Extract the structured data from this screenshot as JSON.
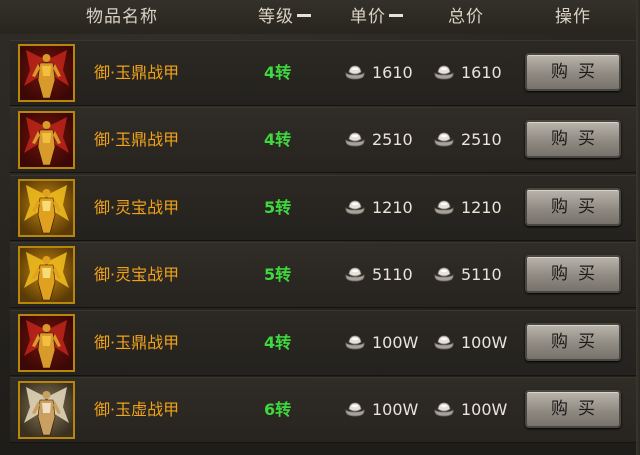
{
  "header": {
    "name": "物品名称",
    "level": "等级",
    "unit_price": "单价",
    "total_price": "总价",
    "action": "操作"
  },
  "rows": [
    {
      "name": "御·玉鼎战甲",
      "level": "4转",
      "unit_price": "1610",
      "total_price": "1610",
      "buy_label": "购买",
      "art": "red"
    },
    {
      "name": "御·玉鼎战甲",
      "level": "4转",
      "unit_price": "2510",
      "total_price": "2510",
      "buy_label": "购买",
      "art": "red"
    },
    {
      "name": "御·灵宝战甲",
      "level": "5转",
      "unit_price": "1210",
      "total_price": "1210",
      "buy_label": "购买",
      "art": "gold"
    },
    {
      "name": "御·灵宝战甲",
      "level": "5转",
      "unit_price": "5110",
      "total_price": "5110",
      "buy_label": "购买",
      "art": "gold"
    },
    {
      "name": "御·玉鼎战甲",
      "level": "4转",
      "unit_price": "100W",
      "total_price": "100W",
      "buy_label": "购买",
      "art": "red"
    },
    {
      "name": "御·玉虚战甲",
      "level": "6转",
      "unit_price": "100W",
      "total_price": "100W",
      "buy_label": "购买",
      "art": "white"
    }
  ],
  "colors": {
    "item_name": "#f0a21a",
    "level": "#3fd93f",
    "header_text": "#d9d2c4",
    "price_text": "#e9e4da"
  },
  "icons": {
    "currency": "silver-ingot-icon",
    "item": "armor-icon",
    "sort": "sort-dash-icon"
  }
}
